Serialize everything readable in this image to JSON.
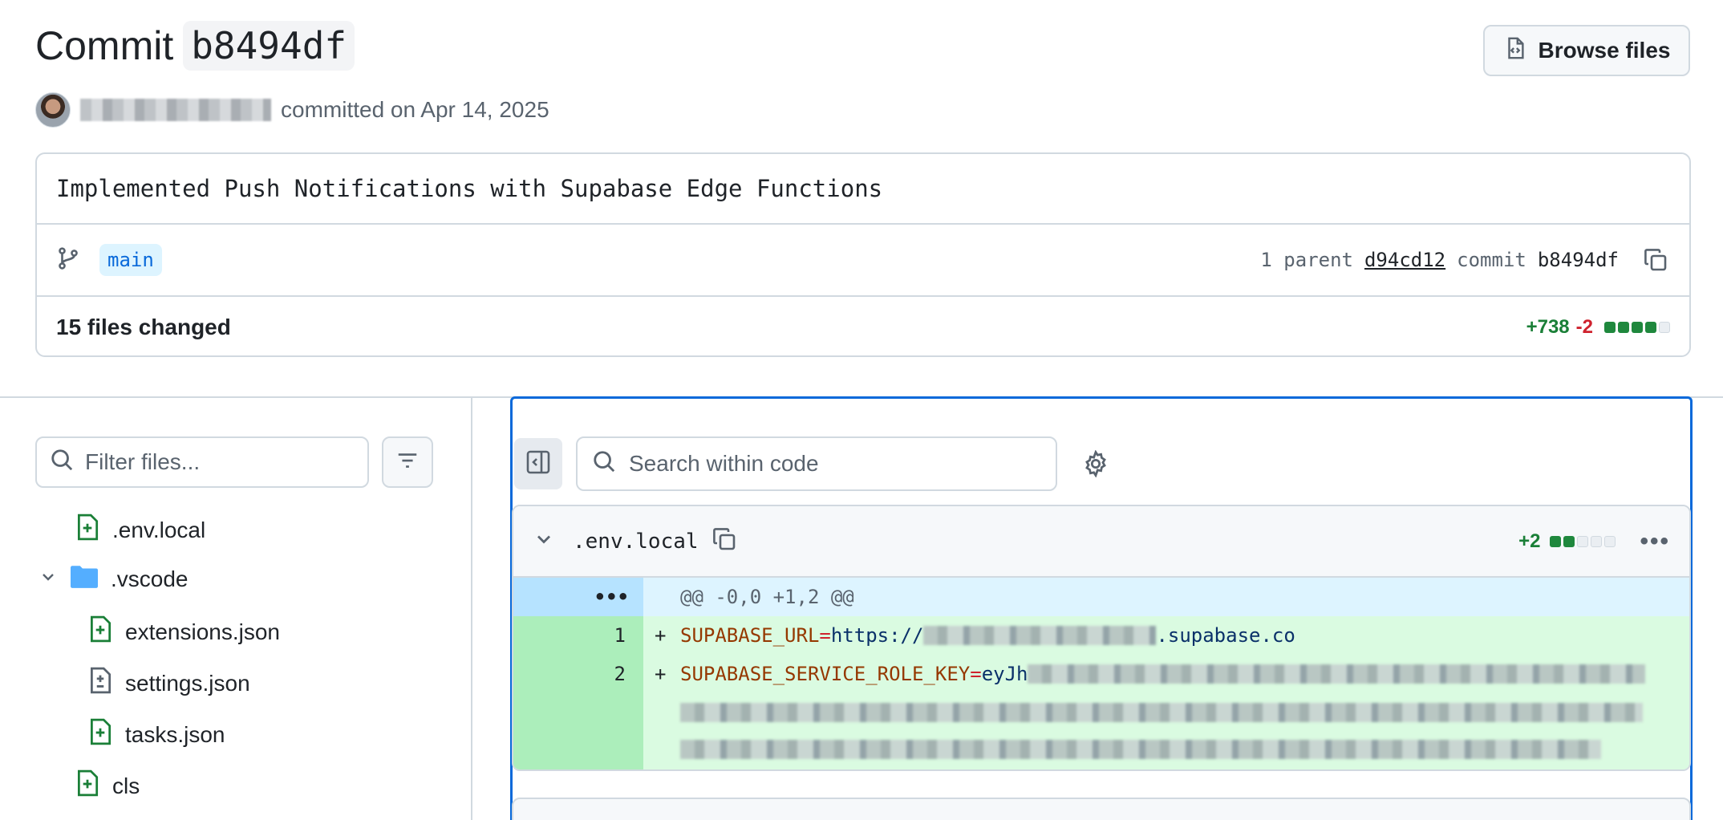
{
  "header": {
    "commit_label": "Commit",
    "commit_hash": "b8494df",
    "browse_label": "Browse files",
    "committed_text": "committed on Apr 14, 2025"
  },
  "commit": {
    "message": "Implemented Push Notifications with Supabase Edge Functions",
    "branch": "main",
    "parent_label": "1 parent",
    "parent_hash": "d94cd12",
    "commit_label": "commit",
    "commit_hash": "b8494df",
    "files_changed": "15 files changed",
    "additions": "+738",
    "deletions": "-2"
  },
  "sidebar": {
    "filter_placeholder": "Filter files...",
    "tree": [
      {
        "label": ".env.local",
        "type": "added"
      },
      {
        "label": ".vscode",
        "type": "folder"
      },
      {
        "label": "extensions.json",
        "type": "added"
      },
      {
        "label": "settings.json",
        "type": "modified"
      },
      {
        "label": "tasks.json",
        "type": "added"
      },
      {
        "label": "cls",
        "type": "added"
      }
    ]
  },
  "code": {
    "search_placeholder": "Search within code",
    "file": {
      "name": ".env.local",
      "additions": "+2",
      "hunk_marker": "•••",
      "hunk_header": "@@ -0,0 +1,2 @@",
      "lines": [
        {
          "num": "1",
          "sign": "+",
          "key": "SUPABASE_URL",
          "eq": "=",
          "value_prefix": "https://",
          "value_suffix": ".supabase.co"
        },
        {
          "num": "2",
          "sign": "+",
          "key": "SUPABASE_SERVICE_ROLE_KEY",
          "eq": "=",
          "value_prefix": "eyJh",
          "value_suffix": ""
        }
      ]
    }
  },
  "colors": {
    "accent": "#0969da",
    "added": "#1a7f37",
    "deleted": "#cf222e"
  }
}
